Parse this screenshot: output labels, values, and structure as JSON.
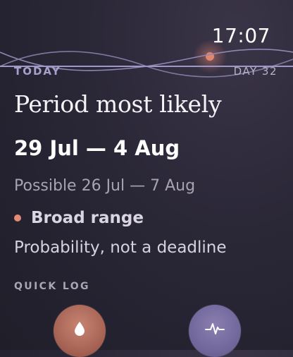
{
  "status": {
    "time": "17:07"
  },
  "header": {
    "today_label": "TODAY",
    "day_label": "DAY  32"
  },
  "prediction": {
    "title": "Period most likely",
    "range": "29 Jul — 4 Aug",
    "possible": "Possible 26 Jul — 7 Aug",
    "confidence_label": "Broad range",
    "note": "Probability, not a deadline"
  },
  "quick_log": {
    "label": "QUICK LOG",
    "buttons": [
      {
        "icon": "drop-icon"
      },
      {
        "icon": "pulse-icon"
      }
    ]
  },
  "colors": {
    "accent_lavender": "#a79ec9",
    "dot_coral": "#e48b78",
    "period_button": "#a25e50",
    "symptom_button": "#6e6498"
  }
}
